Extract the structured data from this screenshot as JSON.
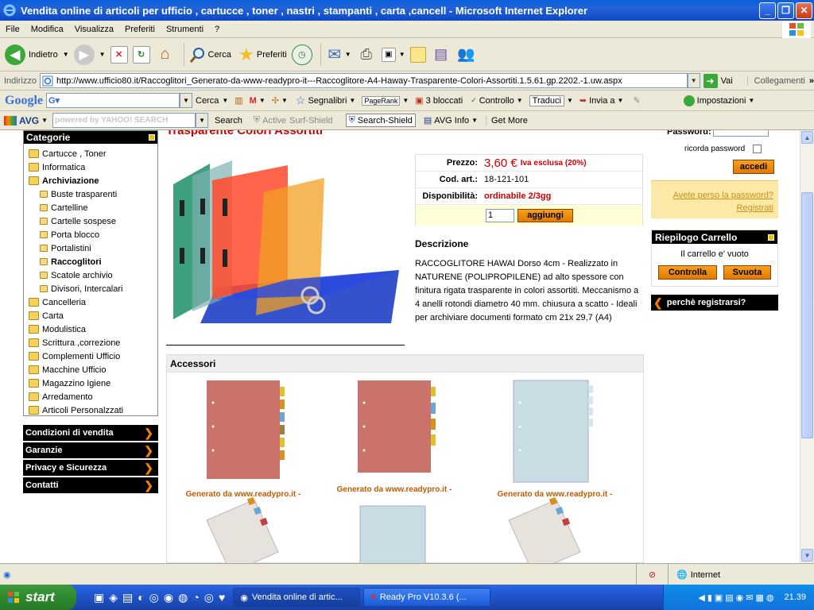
{
  "window": {
    "title": "Vendita online di articoli per ufficio , cartucce , toner , nastri , stampanti , carta ,cancell - Microsoft Internet Explorer"
  },
  "menu": [
    "File",
    "Modifica",
    "Visualizza",
    "Preferiti",
    "Strumenti",
    "?"
  ],
  "toolbar": {
    "back_label": "Indietro",
    "search_label": "Cerca",
    "favorites_label": "Preferiti"
  },
  "address": {
    "label": "Indirizzo",
    "url": "http://www.ufficio80.it/Raccoglitori_Generato-da-www-readypro-it---Raccoglitore-A4-Haway-Trasparente-Colori-Assortiti.1.5.61.gp.2202.-1.uw.aspx",
    "go_label": "Vai",
    "links_label": "Collegamenti"
  },
  "google_bar": {
    "brand": "Google",
    "search_label": "Cerca",
    "bookmarks_label": "Segnalibri",
    "pagerank_label": "PageRank",
    "blocked_label": "3 bloccati",
    "check_label": "Controllo",
    "translate_label": "Traduci",
    "send_label": "Invia a",
    "settings_label": "Impostazioni"
  },
  "avg_bar": {
    "brand": "AVG",
    "yahoo_placeholder": "powered by YAHOO! SEARCH",
    "search_label": "Search",
    "active_label": "Active",
    "surf_shield_label": "Surf-Shield",
    "search_shield_label": "Search-Shield",
    "avg_info_label": "AVG Info",
    "get_more_label": "Get More"
  },
  "categories": {
    "header": "Categorie",
    "items": [
      {
        "label": "Cartucce , Toner",
        "level": 0,
        "bold": false
      },
      {
        "label": "Informatica",
        "level": 0,
        "bold": false
      },
      {
        "label": "Archiviazione",
        "level": 0,
        "bold": true
      },
      {
        "label": "Buste trasparenti",
        "level": 1,
        "bold": false
      },
      {
        "label": "Cartelline",
        "level": 1,
        "bold": false
      },
      {
        "label": "Cartelle sospese",
        "level": 1,
        "bold": false
      },
      {
        "label": "Porta blocco",
        "level": 1,
        "bold": false
      },
      {
        "label": "Portalistini",
        "level": 1,
        "bold": false
      },
      {
        "label": "Raccoglitori",
        "level": 1,
        "bold": true
      },
      {
        "label": "Scatole archivio",
        "level": 1,
        "bold": false
      },
      {
        "label": "Divisori, Intercalari",
        "level": 1,
        "bold": false
      },
      {
        "label": "Cancelleria",
        "level": 0,
        "bold": false
      },
      {
        "label": "Carta",
        "level": 0,
        "bold": false
      },
      {
        "label": "Modulistica",
        "level": 0,
        "bold": false
      },
      {
        "label": "Scrittura ,correzione",
        "level": 0,
        "bold": false
      },
      {
        "label": "Complementi Ufficio",
        "level": 0,
        "bold": false
      },
      {
        "label": "Macchine Ufficio",
        "level": 0,
        "bold": false
      },
      {
        "label": "Magazzino Igiene",
        "level": 0,
        "bold": false
      },
      {
        "label": "Arredamento",
        "level": 0,
        "bold": false
      },
      {
        "label": "Articoli Personalzzati",
        "level": 0,
        "bold": false
      }
    ]
  },
  "side_links": [
    "Condizioni di vendita",
    "Garanzie",
    "Privacy e Sicurezza",
    "Contatti"
  ],
  "product": {
    "title": "Trasparente Colori Assortiti",
    "price_label": "Prezzo:",
    "price": "3,60 €",
    "price_note": "Iva esclusa (20%)",
    "code_label": "Cod. art.:",
    "code": "18-121-101",
    "availability_label": "Disponibilità:",
    "availability": "ordinabile 2/3gg",
    "qty": "1",
    "add_label": "aggiungi",
    "description_title": "Descrizione",
    "description": "RACCOGLITORE HAWAI Dorso 4cm - Realizzato in NATURENE (POLIPROPILENE) ad alto spessore con finitura rigata trasparente in colori assortiti. Meccanismo a 4 anelli rotondi diametro 40 mm. chiusura a scatto - Ideali per archiviare documenti formato cm 21x 29,7 (A4)"
  },
  "accessories": {
    "header": "Accessori",
    "captions": [
      "Generato da www.readypro.it -",
      "Generato da www.readypro.it -",
      "Generato da www.readypro.it -"
    ]
  },
  "login": {
    "password_label": "Password:",
    "remember_label": "ricorda password",
    "login_button": "accedi",
    "forgot_label": "Avete perso la password?",
    "register_label": "Registrati"
  },
  "cart": {
    "header": "Riepilogo Carrello",
    "empty_text": "Il carrello e' vuoto",
    "check_button": "Controlla",
    "empty_button": "Svuota"
  },
  "why_register": "perchè registrarsi?",
  "status": {
    "zone": "Internet"
  },
  "taskbar": {
    "start_label": "start",
    "tasks": [
      "Vendita online di artic...",
      "Ready Pro V10.3.6 (..."
    ],
    "clock": "21.39"
  }
}
